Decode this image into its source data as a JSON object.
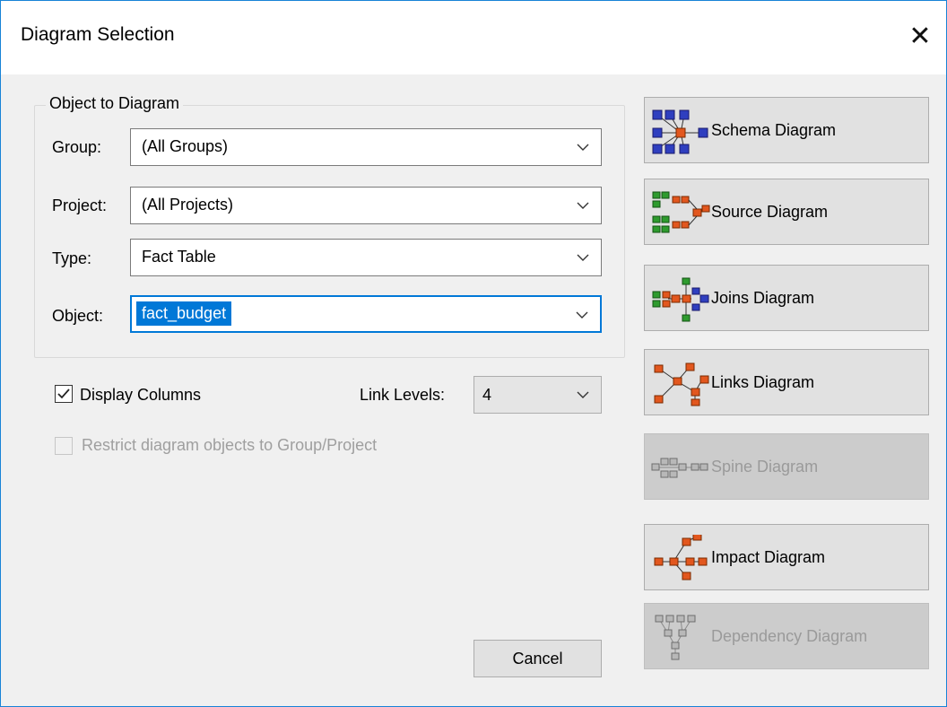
{
  "dialog": {
    "title": "Diagram Selection",
    "close_glyph": "✕"
  },
  "group_box": {
    "legend": "Object to Diagram",
    "fields": [
      {
        "label": "Group:",
        "value": "(All Groups)"
      },
      {
        "label": "Project:",
        "value": "(All Projects)"
      },
      {
        "label": "Type:",
        "value": "Fact Table"
      },
      {
        "label": "Object:",
        "value": "fact_budget"
      }
    ]
  },
  "options": {
    "display_columns": {
      "label": "Display Columns",
      "checked": true
    },
    "restrict": {
      "label": "Restrict diagram objects to Group/Project",
      "checked": false,
      "enabled": false
    },
    "link_levels": {
      "label": "Link Levels:",
      "value": "4"
    }
  },
  "buttons": {
    "cancel": "Cancel"
  },
  "diagram_buttons": [
    {
      "label": "Schema Diagram",
      "icon": "schema-icon",
      "enabled": true
    },
    {
      "label": "Source Diagram",
      "icon": "source-icon",
      "enabled": true
    },
    {
      "label": "Joins Diagram",
      "icon": "joins-icon",
      "enabled": true
    },
    {
      "label": "Links Diagram",
      "icon": "links-icon",
      "enabled": true
    },
    {
      "label": "Spine Diagram",
      "icon": "spine-icon",
      "enabled": false
    },
    {
      "label": "Impact Diagram",
      "icon": "impact-icon",
      "enabled": true
    },
    {
      "label": "Dependency Diagram",
      "icon": "dependency-icon",
      "enabled": false
    }
  ],
  "colors": {
    "accent": "#0078d7",
    "window_border": "#1883d7",
    "node_blue": "#2f3fbf",
    "node_orange": "#e2571e",
    "node_green": "#2e9b2e"
  }
}
